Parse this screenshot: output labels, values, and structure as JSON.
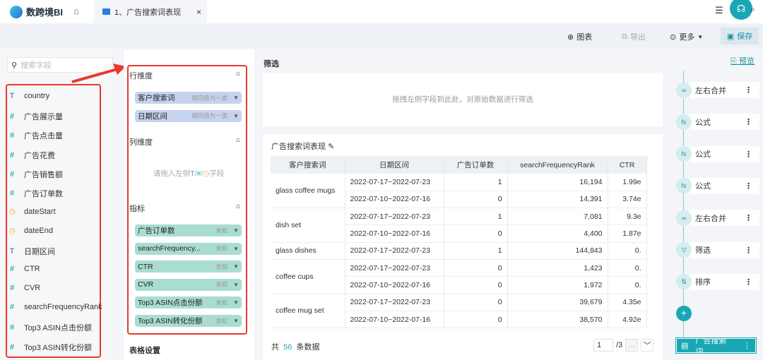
{
  "app": {
    "name": "数跨境BI",
    "tab": "1、广告搜索词表现"
  },
  "toolbar": {
    "chart": "图表",
    "export": "导出",
    "more": "更多",
    "save": "保存"
  },
  "left": {
    "search_placeholder": "搜索字段",
    "fields": [
      {
        "type": "T",
        "name": "country"
      },
      {
        "type": "#",
        "name": "广告展示量"
      },
      {
        "type": "#",
        "name": "广告点击量"
      },
      {
        "type": "#",
        "name": "广告花费"
      },
      {
        "type": "#",
        "name": "广告销售额"
      },
      {
        "type": "#",
        "name": "广告订单数"
      },
      {
        "type": "D",
        "name": "dateStart"
      },
      {
        "type": "D",
        "name": "dateEnd"
      },
      {
        "type": "T",
        "name": "日期区间"
      },
      {
        "type": "#",
        "name": "CTR"
      },
      {
        "type": "#",
        "name": "CVR"
      },
      {
        "type": "#",
        "name": "searchFrequencyRank"
      },
      {
        "type": "#",
        "name": "Top3 ASIN点击份额"
      },
      {
        "type": "#",
        "name": "Top3 ASIN转化份额"
      }
    ]
  },
  "middle": {
    "row_dim": "行维度",
    "col_dim": "列维度",
    "metrics": "指标",
    "table_settings": "表格设置",
    "row_pills": [
      {
        "name": "客户搜索词",
        "agg": "相同值为一类"
      },
      {
        "name": "日期区间",
        "agg": "相同值为一类"
      }
    ],
    "col_hint": {
      "pre": "请拖入左侧",
      "t": "T",
      "n": "#",
      "d": "◷",
      "post": "字段"
    },
    "metric_pills": [
      {
        "name": "广告订单数",
        "agg": "求和"
      },
      {
        "name": "searchFrequency...",
        "agg": "求和"
      },
      {
        "name": "CTR",
        "agg": "求和"
      },
      {
        "name": "CVR",
        "agg": "求和"
      },
      {
        "name": "Top3 ASIN点击份额",
        "agg": "求和"
      },
      {
        "name": "Top3 ASIN转化份额",
        "agg": "求和"
      }
    ]
  },
  "filter": {
    "label": "筛选",
    "hint": "拖拽左侧字段到此处，对原始数据进行筛选"
  },
  "table": {
    "title": "广告搜索词表现",
    "headers": [
      "客户搜索词",
      "日期区间",
      "广告订单数",
      "searchFrequencyRank",
      "CTR"
    ],
    "groups": [
      {
        "term": "glass coffee mugs",
        "rows": [
          [
            "2022-07-17~2022-07-23",
            "1",
            "16,194",
            "1.99e"
          ],
          [
            "2022-07-10~2022-07-16",
            "0",
            "14,391",
            "3.74e"
          ]
        ]
      },
      {
        "term": "dish set",
        "rows": [
          [
            "2022-07-17~2022-07-23",
            "1",
            "7,081",
            "9.3e"
          ],
          [
            "2022-07-10~2022-07-16",
            "0",
            "4,400",
            "1.87e"
          ]
        ]
      },
      {
        "term": "glass dishes",
        "rows": [
          [
            "2022-07-17~2022-07-23",
            "1",
            "144,843",
            "0."
          ]
        ]
      },
      {
        "term": "coffee cups",
        "rows": [
          [
            "2022-07-17~2022-07-23",
            "0",
            "1,423",
            "0."
          ],
          [
            "2022-07-10~2022-07-16",
            "0",
            "1,972",
            "0."
          ]
        ]
      },
      {
        "term": "coffee mug set",
        "rows": [
          [
            "2022-07-17~2022-07-23",
            "0",
            "39,679",
            "4.35e"
          ],
          [
            "2022-07-10~2022-07-16",
            "0",
            "38,570",
            "4.92e"
          ]
        ]
      }
    ]
  },
  "footer": {
    "pre": "共",
    "total": "56",
    "post": "条数据",
    "page": "1",
    "pages": "/3"
  },
  "right": {
    "preview": "预览",
    "steps": [
      {
        "icon": "∞",
        "name": "左右合并"
      },
      {
        "icon": "fx",
        "name": "公式"
      },
      {
        "icon": "fx",
        "name": "公式"
      },
      {
        "icon": "fx",
        "name": "公式"
      },
      {
        "icon": "∞",
        "name": "左右合并"
      },
      {
        "icon": "▽",
        "name": "筛选"
      },
      {
        "icon": "⇅",
        "name": "排序"
      }
    ],
    "last": "广告搜索词..."
  }
}
